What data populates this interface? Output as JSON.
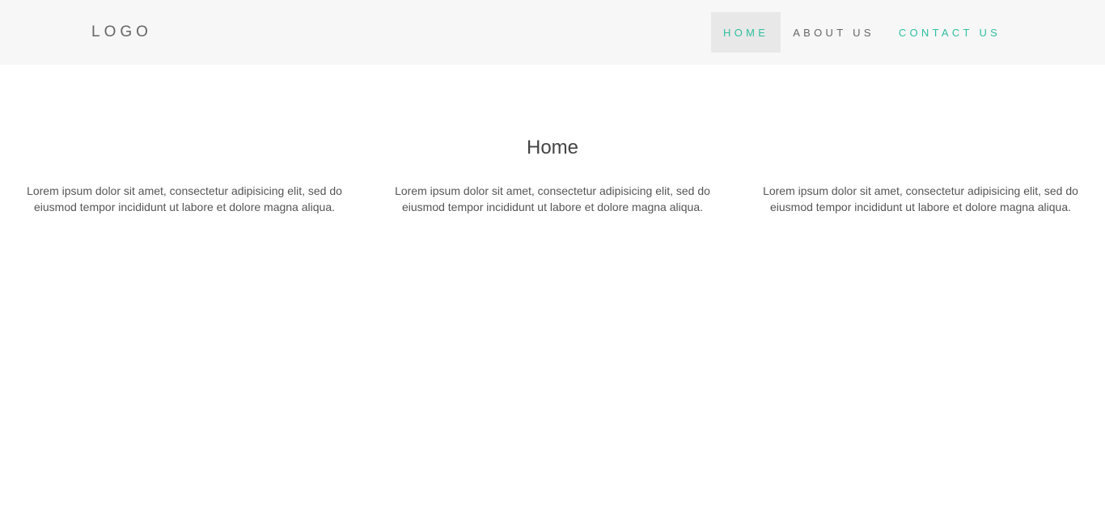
{
  "header": {
    "logo": "LOGO",
    "nav": [
      {
        "label": "HOME",
        "state": "active"
      },
      {
        "label": "ABOUT US",
        "state": "normal"
      },
      {
        "label": "CONTACT US",
        "state": "highlighted"
      }
    ]
  },
  "main": {
    "title": "Home",
    "columns": [
      {
        "text": "Lorem ipsum dolor sit amet, consectetur adipisicing elit, sed do eiusmod tempor incididunt ut labore et dolore magna aliqua."
      },
      {
        "text": "Lorem ipsum dolor sit amet, consectetur adipisicing elit, sed do eiusmod tempor incididunt ut labore et dolore magna aliqua."
      },
      {
        "text": "Lorem ipsum dolor sit amet, consectetur adipisicing elit, sed do eiusmod tempor incididunt ut labore et dolore magna aliqua."
      }
    ]
  },
  "colors": {
    "accent": "#2fbf9f",
    "navbar_bg": "#f7f7f7",
    "active_bg": "#e8e8e8"
  }
}
